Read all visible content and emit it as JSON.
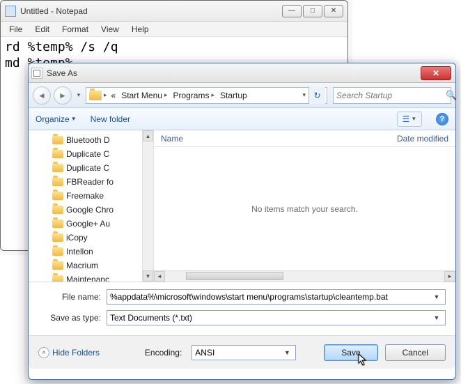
{
  "notepad": {
    "title": "Untitled - Notepad",
    "menu": {
      "file": "File",
      "edit": "Edit",
      "format": "Format",
      "view": "View",
      "help": "Help"
    },
    "content": "rd %temp% /s /q\nmd %temp%"
  },
  "dialog": {
    "title": "Save As",
    "breadcrumbs": {
      "pre": "«",
      "a": "Start Menu",
      "b": "Programs",
      "c": "Startup"
    },
    "search_placeholder": "Search Startup",
    "toolbar": {
      "organize": "Organize",
      "newfolder": "New folder"
    },
    "tree": [
      "Bluetooth D",
      "Duplicate C",
      "Duplicate C",
      "FBReader fo",
      "Freemake",
      "Google Chro",
      "Google+ Au",
      "iCopy",
      "Intellon",
      "Macrium",
      "Maintenanc"
    ],
    "columns": {
      "name": "Name",
      "date": "Date modified"
    },
    "empty": "No items match your search.",
    "filename_label": "File name:",
    "filename_value": "%appdata%\\microsoft\\windows\\start menu\\programs\\startup\\cleantemp.bat",
    "savetype_label": "Save as type:",
    "savetype_value": "Text Documents (*.txt)",
    "encoding_label": "Encoding:",
    "encoding_value": "ANSI",
    "hide_folders": "Hide Folders",
    "save": "Save",
    "cancel": "Cancel"
  }
}
